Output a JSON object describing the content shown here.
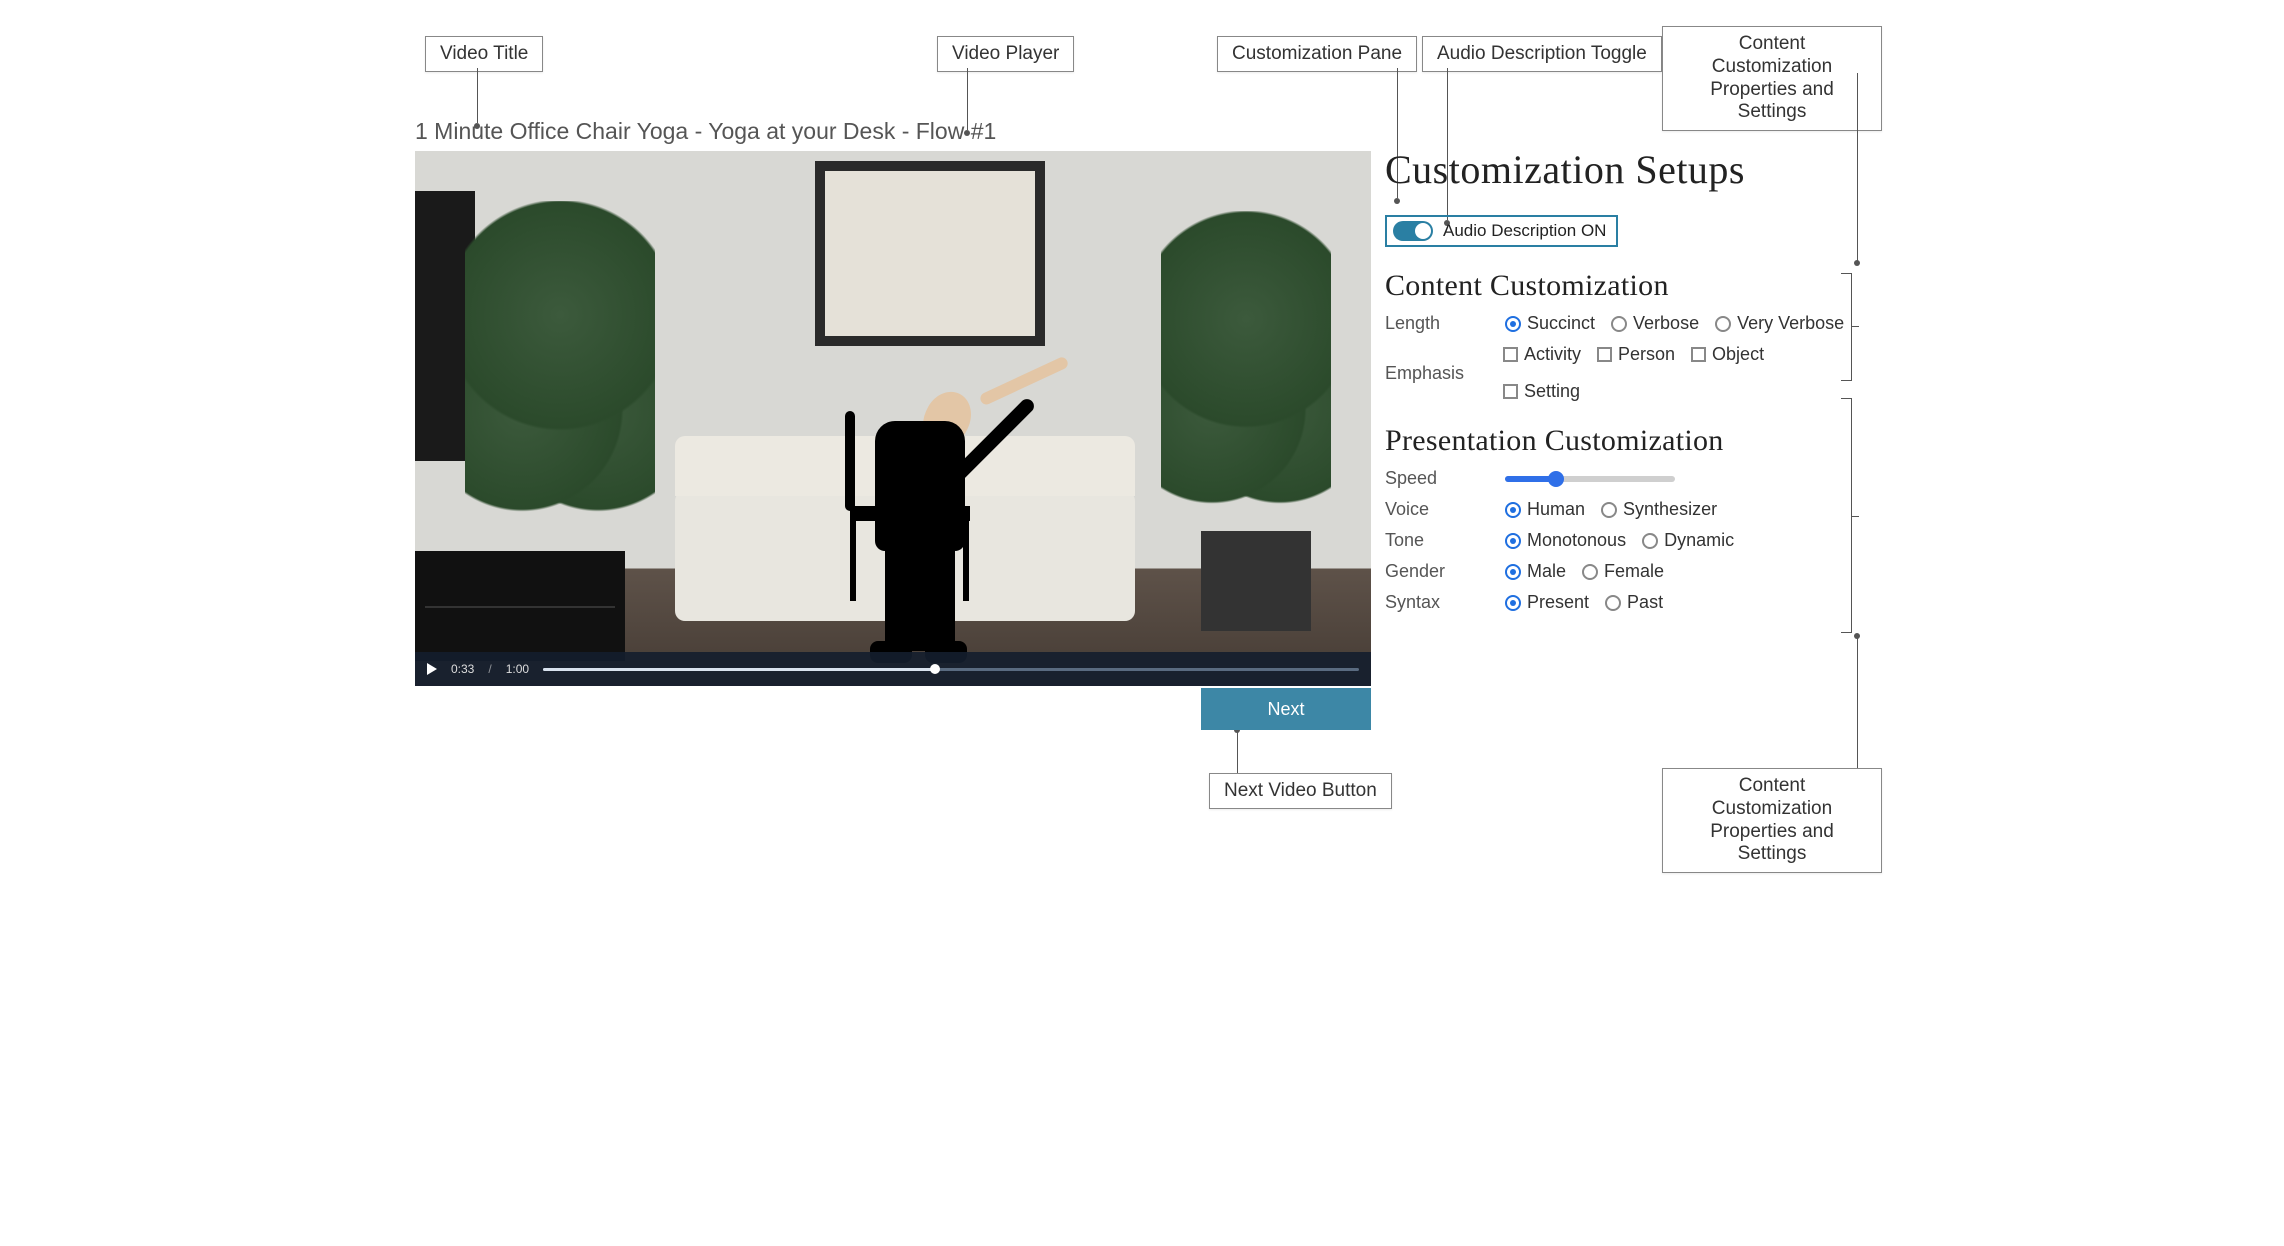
{
  "callouts": {
    "videoTitle": "Video Title",
    "videoPlayer": "Video Player",
    "customizationPane": "Customization Pane",
    "audioDescToggle": "Audio Description Toggle",
    "contentCustomProps": "Content Customization Properties and Settings",
    "nextVideoButton": "Next Video Button",
    "contentCustomProps2": "Content Customization Properties and Settings"
  },
  "video": {
    "title": "1 Minute Office Chair Yoga - Yoga at your Desk - Flow #1",
    "currentTime": "0:33",
    "duration": "1:00",
    "nextLabel": "Next"
  },
  "pane": {
    "title": "Customization Setups",
    "audioToggle": {
      "label": "Audio Description ON",
      "on": true
    },
    "content": {
      "heading": "Content Customization",
      "lengthLabel": "Length",
      "lengthOptions": [
        "Succinct",
        "Verbose",
        "Very Verbose"
      ],
      "lengthSelected": "Succinct",
      "emphasisLabel": "Emphasis",
      "emphasisOptions": [
        "Activity",
        "Person",
        "Object",
        "Setting"
      ]
    },
    "presentation": {
      "heading": "Presentation Customization",
      "speedLabel": "Speed",
      "speedPercent": 30,
      "voiceLabel": "Voice",
      "voiceOptions": [
        "Human",
        "Synthesizer"
      ],
      "voiceSelected": "Human",
      "toneLabel": "Tone",
      "toneOptions": [
        "Monotonous",
        "Dynamic"
      ],
      "toneSelected": "Monotonous",
      "genderLabel": "Gender",
      "genderOptions": [
        "Male",
        "Female"
      ],
      "genderSelected": "Male",
      "syntaxLabel": "Syntax",
      "syntaxOptions": [
        "Present",
        "Past"
      ],
      "syntaxSelected": "Present"
    }
  }
}
